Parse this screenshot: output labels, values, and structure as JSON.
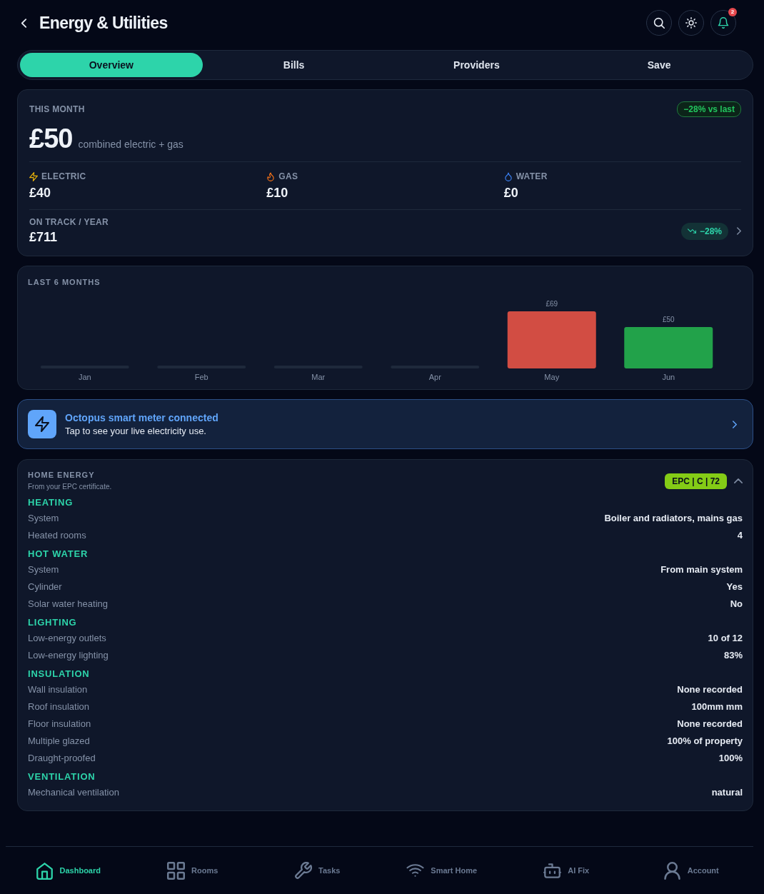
{
  "header": {
    "title": "Energy & Utilities",
    "notification_count": "2"
  },
  "tabs": [
    {
      "label": "Overview",
      "selected": true
    },
    {
      "label": "Bills",
      "selected": false
    },
    {
      "label": "Providers",
      "selected": false
    },
    {
      "label": "Save",
      "selected": false
    }
  ],
  "this_month": {
    "label": "THIS MONTH",
    "change_badge": "−28% vs last",
    "amount": "£50",
    "caption": "combined electric + gas",
    "breakdown": [
      {
        "kind": "electric",
        "label": "ELECTRIC",
        "amount": "£40"
      },
      {
        "kind": "gas",
        "label": "GAS",
        "amount": "£10"
      },
      {
        "kind": "water",
        "label": "WATER",
        "amount": "£0"
      }
    ],
    "on_track": {
      "label": "ON TRACK / YEAR",
      "amount": "£711",
      "trend": "−28%"
    }
  },
  "history": {
    "chart_data": {
      "type": "bar",
      "title": "LAST 6 MONTHS",
      "categories": [
        "Jan",
        "Feb",
        "Mar",
        "Apr",
        "May",
        "Jun"
      ],
      "values": [
        null,
        null,
        null,
        null,
        69,
        50
      ],
      "value_labels": [
        null,
        null,
        null,
        null,
        "£69",
        "£50"
      ]
    }
  },
  "meter_banner": {
    "title": "Octopus smart meter connected",
    "subtitle": "Tap to see your live electricity use."
  },
  "home_energy": {
    "title": "HOME ENERGY",
    "subtitle": "From your EPC certificate.",
    "epc_badge": "EPC | C | 72",
    "expanded": true,
    "sections": [
      {
        "heading": "HEATING",
        "rows": [
          {
            "label": "System",
            "value": "Boiler and radiators, mains gas"
          },
          {
            "label": "Heated rooms",
            "value": "4"
          }
        ]
      },
      {
        "heading": "HOT WATER",
        "rows": [
          {
            "label": "System",
            "value": "From main system"
          },
          {
            "label": "Cylinder",
            "value": "Yes"
          },
          {
            "label": "Solar water heating",
            "value": "No"
          }
        ]
      },
      {
        "heading": "LIGHTING",
        "rows": [
          {
            "label": "Low-energy outlets",
            "value": "10 of 12"
          },
          {
            "label": "Low-energy lighting",
            "value": "83%"
          }
        ]
      },
      {
        "heading": "INSULATION",
        "rows": [
          {
            "label": "Wall insulation",
            "value": "None recorded"
          },
          {
            "label": "Roof insulation",
            "value": "100mm mm"
          },
          {
            "label": "Floor insulation",
            "value": "None recorded"
          },
          {
            "label": "Multiple glazed",
            "value": "100% of property"
          },
          {
            "label": "Draught-proofed",
            "value": "100%"
          }
        ]
      },
      {
        "heading": "VENTILATION",
        "rows": [
          {
            "label": "Mechanical ventilation",
            "value": "natural"
          }
        ]
      }
    ]
  },
  "bottom_nav": [
    {
      "kind": "home",
      "label": "Dashboard",
      "selected": true
    },
    {
      "kind": "grid",
      "label": "Rooms",
      "selected": false
    },
    {
      "kind": "wrench",
      "label": "Tasks",
      "selected": false
    },
    {
      "kind": "wifi",
      "label": "Smart Home",
      "selected": false
    },
    {
      "kind": "robot",
      "label": "AI Fix",
      "selected": false
    },
    {
      "kind": "user",
      "label": "Account",
      "selected": false
    }
  ]
}
